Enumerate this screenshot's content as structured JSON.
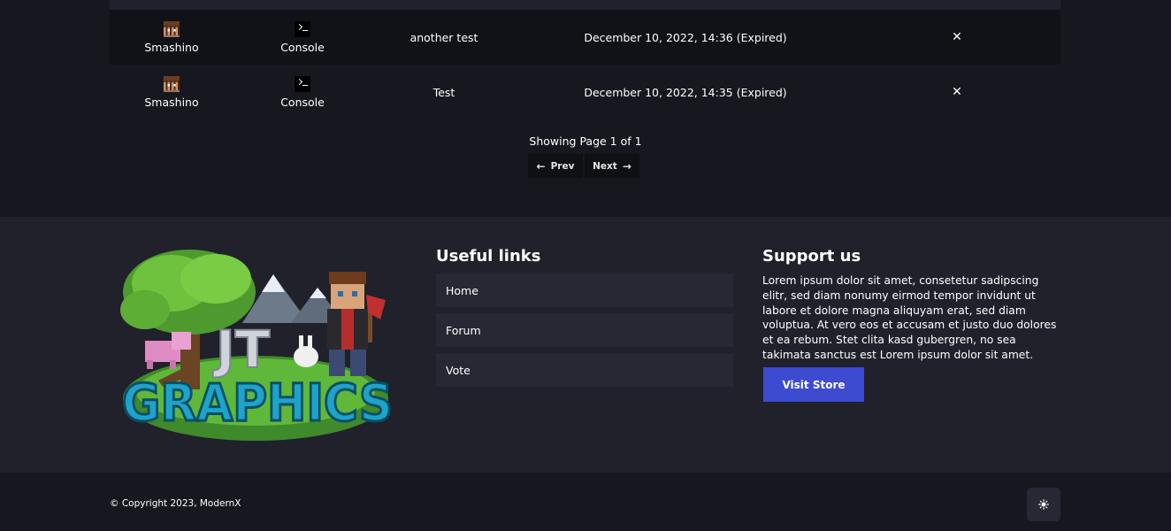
{
  "punishments": [
    {
      "issuer": "Smashino",
      "target": "Console",
      "reason": "another test",
      "date": "December 10, 2022, 14:36 (Expired)"
    },
    {
      "issuer": "Smashino",
      "target": "Console",
      "reason": "Test",
      "date": "December 10, 2022, 14:35 (Expired)"
    }
  ],
  "pagination": {
    "status": "Showing Page 1 of 1",
    "prev_label": "Prev",
    "next_label": "Next"
  },
  "footer": {
    "logo_text": "JT GRAPHICS",
    "links_title": "Useful links",
    "links": [
      "Home",
      "Forum",
      "Vote"
    ],
    "support_title": "Support us",
    "support_text": "Lorem ipsum dolor sit amet, consetetur sadipscing elitr, sed diam nonumy eirmod tempor invidunt ut labore et dolore magna aliquyam erat, sed diam voluptua. At vero eos et accusam et justo duo dolores et ea rebum. Stet clita kasd gubergren, no sea takimata sanctus est Lorem ipsum dolor sit amet.",
    "store_button": "Visit Store"
  },
  "bottom": {
    "copyright": "© Copyright 2023, ModernX"
  },
  "icons": {
    "issuer_avatar": "player-head-icon",
    "target_avatar": "console-icon",
    "remove": "close-icon",
    "prev": "arrow-left-icon",
    "next": "arrow-right-icon",
    "theme": "sun-icon"
  },
  "colors": {
    "accent": "#3d4bd0",
    "background": "#17181f",
    "footer_bg": "#20212b",
    "row_alt": "#111217"
  }
}
